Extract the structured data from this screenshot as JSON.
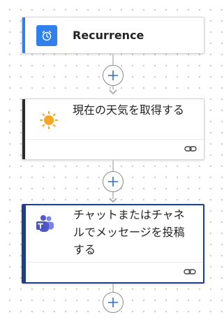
{
  "flow": {
    "steps": [
      {
        "title": "Recurrence",
        "icon": "alarm-clock-icon",
        "accent_color": "#2f80ed",
        "icon_bg": "#2f80ed"
      },
      {
        "title": "現在の天気を取得する",
        "icon": "sun-icon",
        "accent_color": "#2b2b2b",
        "icon_color": "#f5a623"
      },
      {
        "title": "チャットまたはチャネルでメッセージを投稿する",
        "icon": "teams-icon",
        "accent_color": "#1f3d8a",
        "icon_color": "#5059c9",
        "selected": true
      }
    ],
    "add_buttons": [
      "add-step",
      "add-step",
      "add-step"
    ],
    "link_icon": "link-icon"
  }
}
